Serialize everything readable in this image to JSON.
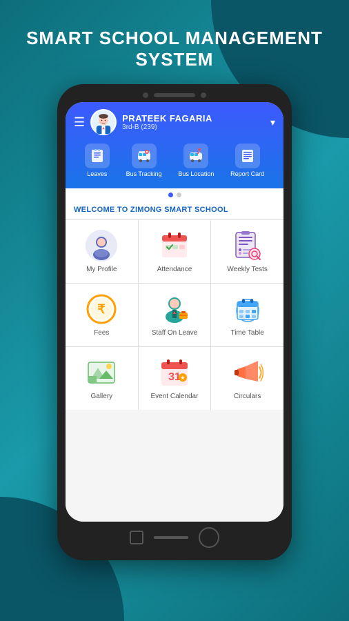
{
  "app": {
    "title_line1": "SMART SCHOOL MANAGEMENT",
    "title_line2": "SYSTEM",
    "background_color": "#0d6e7a"
  },
  "header": {
    "user_name": "PRATEEK FAGARIA",
    "user_class": "3rd-B (239)",
    "dropdown_symbol": "▾"
  },
  "nav_items": [
    {
      "id": "leaves",
      "label": "Leaves",
      "icon": "📋"
    },
    {
      "id": "bus-tracking",
      "label": "Bus Tracking",
      "icon": "🚌"
    },
    {
      "id": "bus-location",
      "label": "Bus Location",
      "icon": "📍"
    },
    {
      "id": "report-card",
      "label": "Report Card",
      "icon": "📄"
    }
  ],
  "pagination": {
    "total": 2,
    "active": 0
  },
  "welcome": {
    "text": "WELCOME TO ZIMONG SMART SCHOOL"
  },
  "grid_items": [
    {
      "id": "my-profile",
      "label": "My Profile",
      "icon": "👤",
      "color": "#5c6bc0"
    },
    {
      "id": "attendance",
      "label": "Attendance",
      "icon": "📅",
      "color": "#ef5350"
    },
    {
      "id": "weekly-tests",
      "label": "Weekly Tests",
      "icon": "📋",
      "color": "#7e57c2"
    },
    {
      "id": "fees",
      "label": "Fees",
      "icon": "₹",
      "color": "#ffa000"
    },
    {
      "id": "staff-on-leave",
      "label": "Staff On Leave",
      "icon": "👨‍💼",
      "color": "#26a69a"
    },
    {
      "id": "time-table",
      "label": "Time Table",
      "icon": "🗓",
      "color": "#42a5f5"
    },
    {
      "id": "gallery",
      "label": "Gallery",
      "icon": "🖼",
      "color": "#66bb6a"
    },
    {
      "id": "event-calendar",
      "label": "Event Calendar",
      "icon": "📆",
      "color": "#ef5350"
    },
    {
      "id": "circulars",
      "label": "Circulars",
      "icon": "📢",
      "color": "#ff7043"
    }
  ]
}
